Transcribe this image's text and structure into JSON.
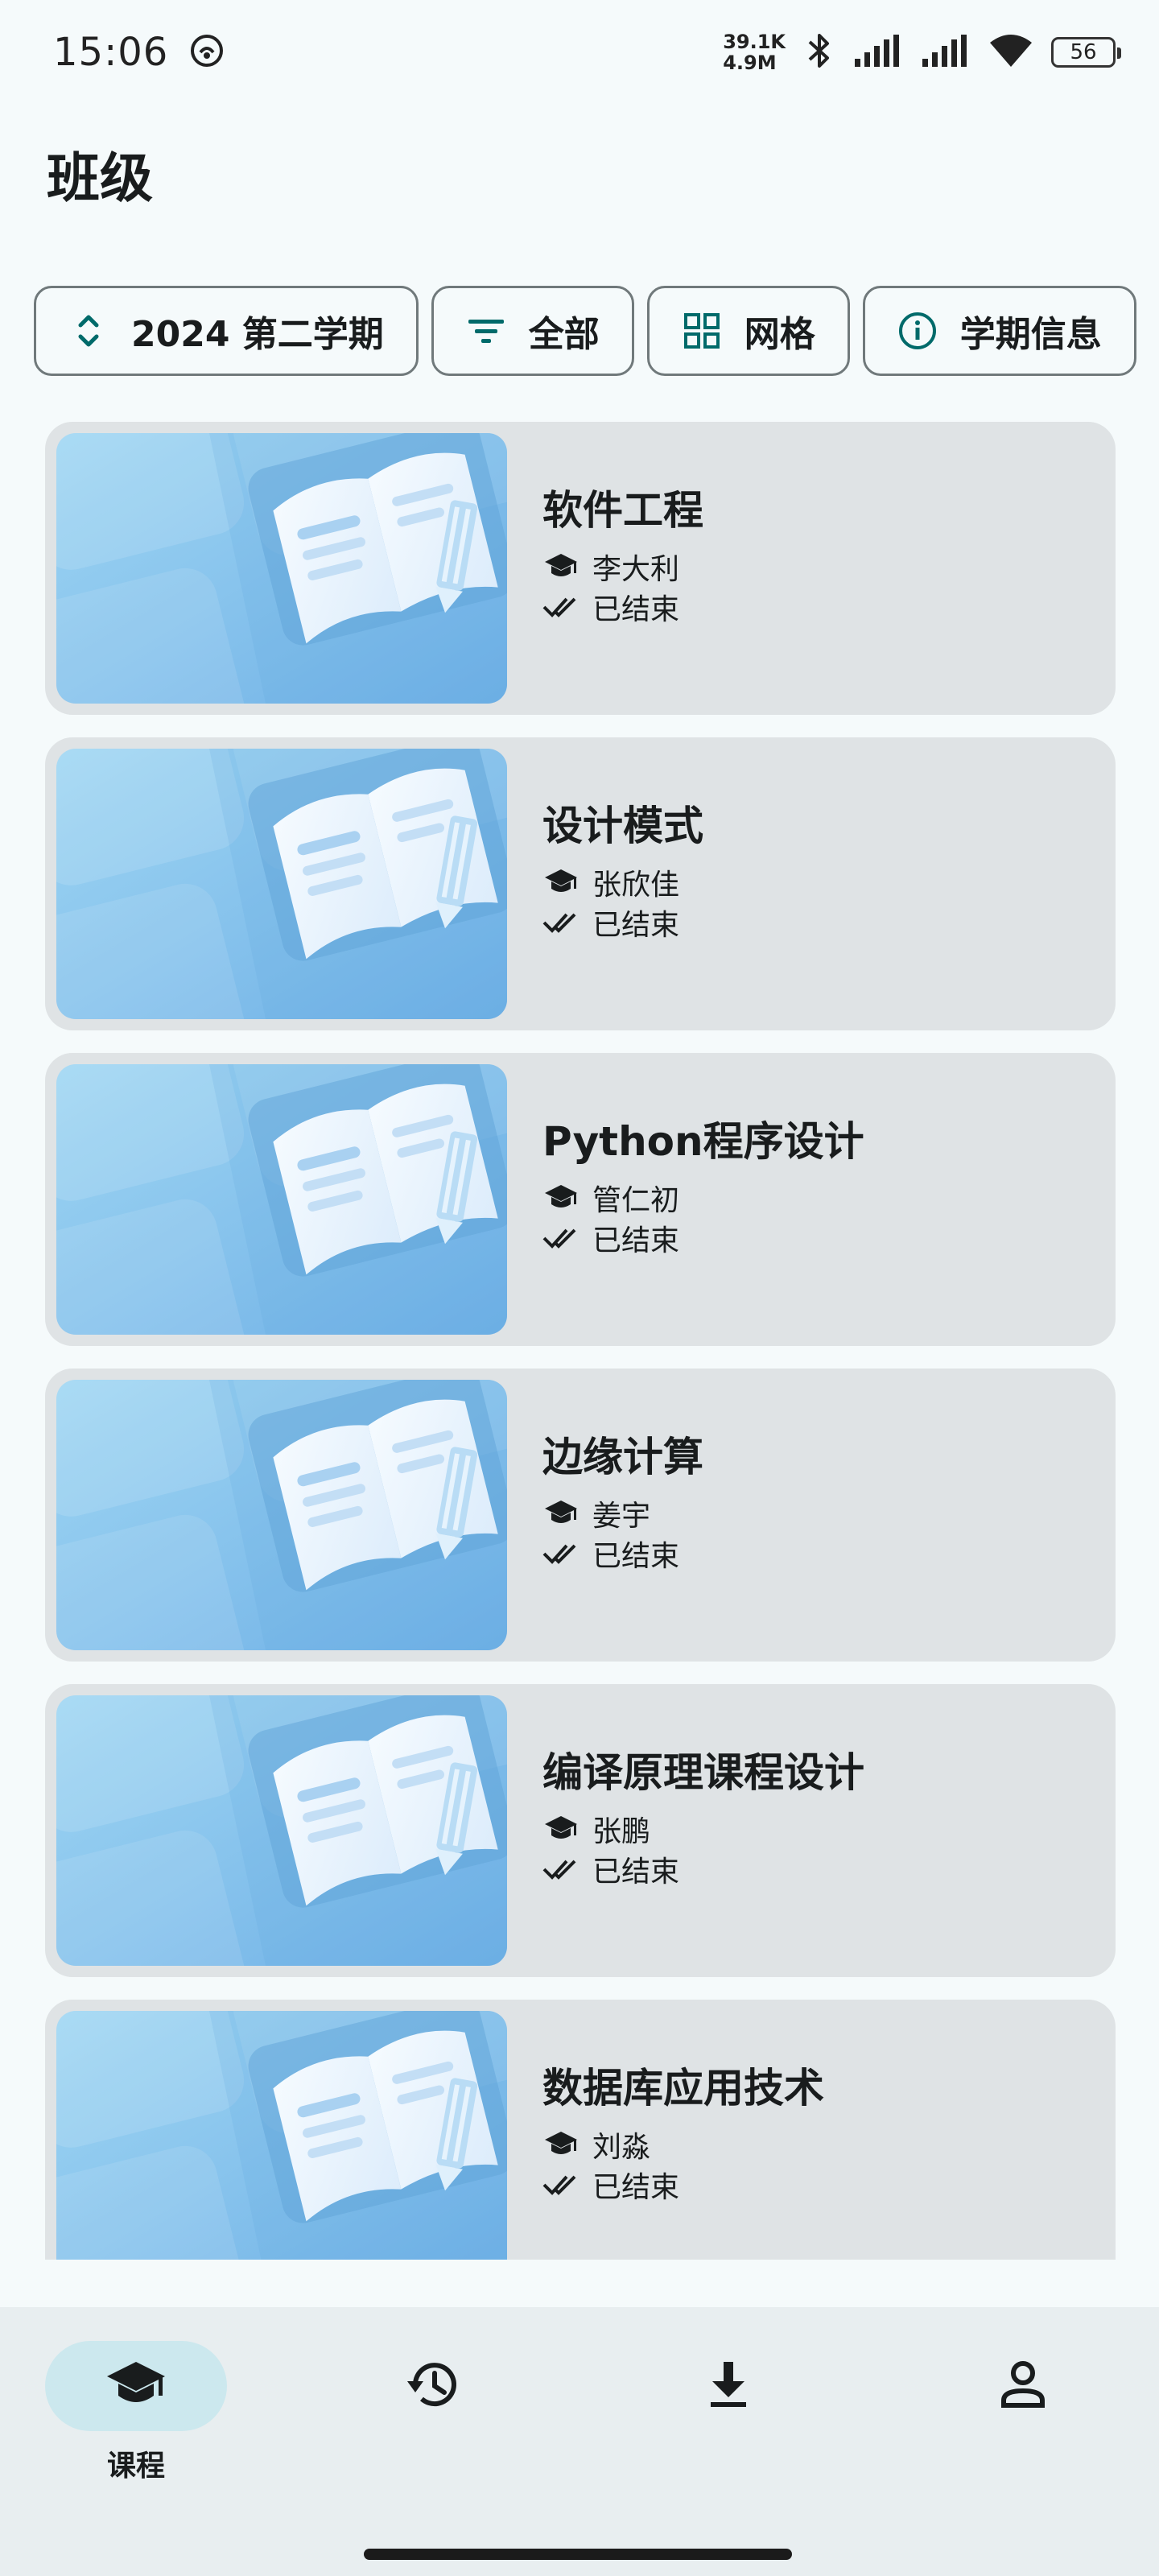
{
  "status_bar": {
    "time": "15:06",
    "net_speed_up": "39.1K",
    "net_speed_down": "4.9M",
    "battery": "56",
    "icons": [
      "sync-icon",
      "bluetooth-icon",
      "signal-icon",
      "signal-icon-2",
      "wifi-icon",
      "battery-icon"
    ]
  },
  "page": {
    "title": "班级"
  },
  "chips": [
    {
      "label": "2024 第二学期",
      "icon": "unfold-icon"
    },
    {
      "label": "全部",
      "icon": "filter-icon"
    },
    {
      "label": "网格",
      "icon": "grid-icon"
    },
    {
      "label": "学期信息",
      "icon": "info-icon"
    }
  ],
  "courses": [
    {
      "title": "软件工程",
      "teacher": "李大利",
      "status": "已结束"
    },
    {
      "title": "设计模式",
      "teacher": "张欣佳",
      "status": "已结束"
    },
    {
      "title": "Python程序设计",
      "teacher": "管仁初",
      "status": "已结束"
    },
    {
      "title": "边缘计算",
      "teacher": "姜宇",
      "status": "已结束"
    },
    {
      "title": "编译原理课程设计",
      "teacher": "张鹏",
      "status": "已结束"
    },
    {
      "title": "数据库应用技术",
      "teacher": "刘淼",
      "status": "已结束"
    }
  ],
  "bottom_nav": [
    {
      "label": "课程",
      "icon": "school-icon",
      "active": true
    },
    {
      "label": "",
      "icon": "history-icon",
      "active": false
    },
    {
      "label": "",
      "icon": "download-icon",
      "active": false
    },
    {
      "label": "",
      "icon": "person-icon",
      "active": false
    }
  ],
  "colors": {
    "background": "#f5fafb",
    "card": "#dfe3e5",
    "accent": "#006a6a",
    "nav_active": "#cce8ee"
  }
}
